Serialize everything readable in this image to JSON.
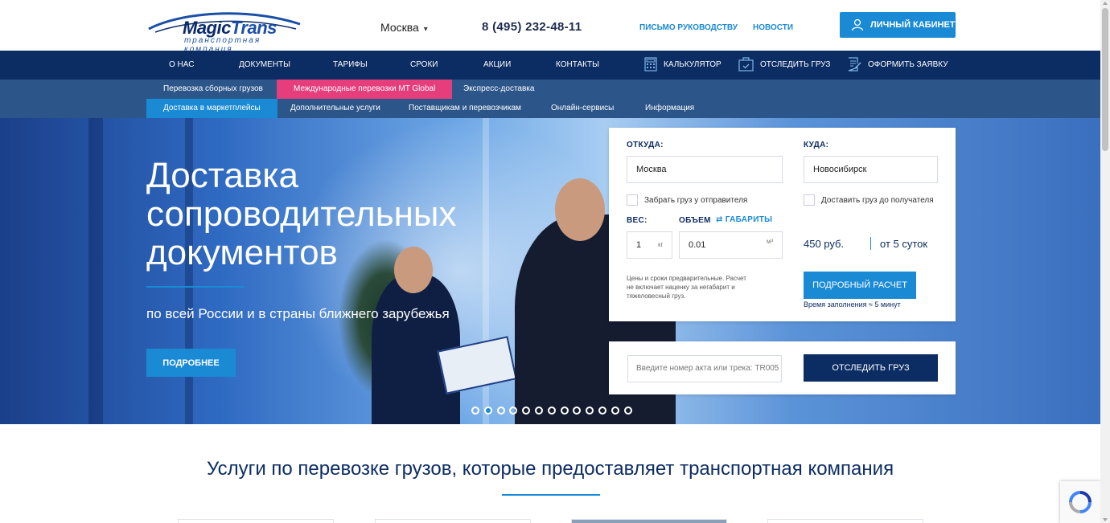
{
  "header": {
    "logo_title_part1": "Magic",
    "logo_title_part2": "Trans",
    "logo_subtitle": "транспортная компания",
    "city": "Москва",
    "phone": "8 (495) 232-48-11",
    "link_letter": "ПИСЬМО РУКОВОДСТВУ",
    "link_news": "НОВОСТИ",
    "cabinet_label": "ЛИЧНЫЙ КАБИНЕТ"
  },
  "main_nav": {
    "items": [
      "О НАС",
      "ДОКУМЕНТЫ",
      "ТАРИФЫ",
      "СРОКИ",
      "АКЦИИ",
      "КОНТАКТЫ"
    ],
    "calculator": "КАЛЬКУЛЯТОР",
    "track": "ОТСЛЕДИТЬ ГРУЗ",
    "order": "ОФОРМИТЬ ЗАЯВКУ"
  },
  "sub_nav": {
    "row1": [
      "Перевозка сборных грузов",
      "Международные перевозки MT Global",
      "Экспресс-доставка"
    ],
    "row2": [
      "Доставка в маркетплейсы",
      "Дополнительные услуги",
      "Поставщикам и перевозчикам",
      "Онлайн-сервисы",
      "Информация"
    ]
  },
  "hero": {
    "title": "Доставка сопроводительных документов",
    "subtitle": "по всей России и в страны ближнего зарубежья",
    "button": "ПОДРОБНЕЕ",
    "slides_total": 13,
    "slide_active": 2
  },
  "calculator": {
    "from_label": "ОТКУДА:",
    "from_value": "Москва",
    "to_label": "КУДА:",
    "to_value": "Новосибирск",
    "pickup_label": "Забрать груз у отправителя",
    "pickup_checked": false,
    "delivery_label": "Доставить груз до получателя",
    "delivery_checked": false,
    "weight_label": "ВЕС:",
    "weight_value": "1",
    "weight_unit": "кг",
    "volume_label": "ОБЪЕМ",
    "dimensions_label": "ГАБАРИТЫ",
    "volume_value": "0.01",
    "volume_unit": "м³",
    "price": "450 руб.",
    "term": "от 5 суток",
    "note": "Цены и сроки предварительные. Расчет не включает наценку за негабарит и тяжеловесный груз.",
    "detail_button": "ПОДРОБНЫЙ РАСЧЕТ",
    "fill_time": "Время заполнения ≈ 5 минут"
  },
  "tracking": {
    "placeholder": "Введите номер акта или трека: TR005",
    "button": "ОТСЛЕДИТЬ ГРУЗ"
  },
  "services": {
    "title": "Услуги по перевозке грузов, которые предоставляет транспортная компания"
  },
  "colors": {
    "navy": "#0c2d64",
    "subnav": "#2c558a",
    "accent_blue": "#1a8ad4",
    "pink": "#e63d7c"
  }
}
